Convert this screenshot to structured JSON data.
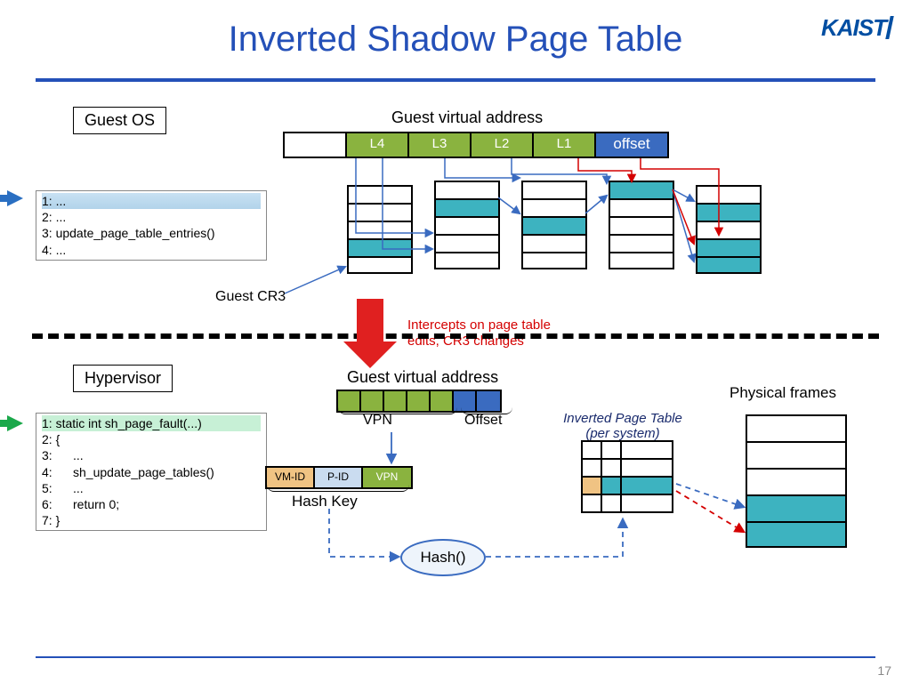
{
  "slide": {
    "title": "Inverted Shadow Page Table",
    "page_number": "17",
    "logo": "KAIST"
  },
  "labels": {
    "guest_os": "Guest OS",
    "hypervisor": "Hypervisor",
    "guest_virtual_address": "Guest virtual address",
    "guest_cr3": "Guest CR3",
    "intercept": "Intercepts on page table\nedits, CR3 changes",
    "vpn": "VPN",
    "offset": "Offset",
    "hash_key": "Hash Key",
    "inverted_page_table": "Inverted Page Table\n(per system)",
    "physical_frames": "Physical frames",
    "hash_fn": "Hash()"
  },
  "address_levels": {
    "blank": "",
    "l4": "L4",
    "l3": "L3",
    "l2": "L2",
    "l1": "L1",
    "offset": "offset"
  },
  "hash_components": {
    "vmid": "VM-ID",
    "pid": "P-ID",
    "vpn": "VPN"
  },
  "code_top": {
    "l1": "1: ...",
    "l2": "2: ...",
    "l3": "3: update_page_table_entries()",
    "l4": "4: ..."
  },
  "code_bot": {
    "l1": "1: static int sh_page_fault(...)",
    "l2": "2: {",
    "l3": "3:      ...",
    "l4": "4:      sh_update_page_tables()",
    "l5": "5:      ...",
    "l6": "6:      return 0;",
    "l7": "7: }"
  }
}
